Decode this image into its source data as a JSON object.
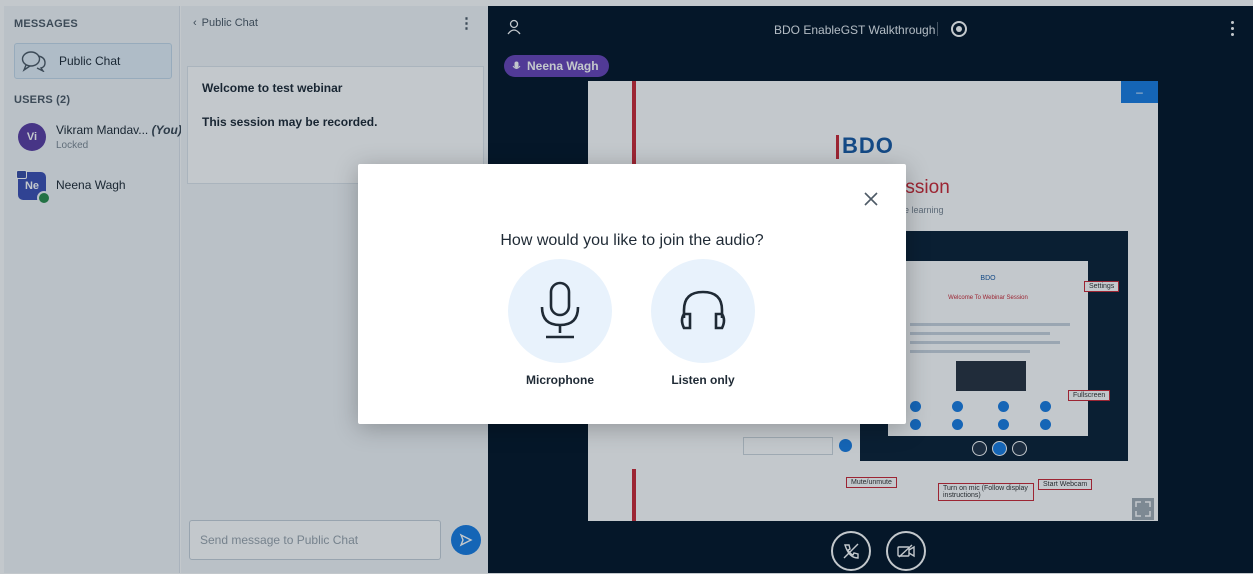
{
  "users_panel": {
    "messages_heading": "MESSAGES",
    "public_chat_entry": "Public Chat",
    "users_heading": "USERS (2)",
    "users": [
      {
        "initials": "Vi",
        "name": "Vikram Mandav...",
        "you_tag": "(You)",
        "status": "Locked",
        "avatar_color": "#5c3fa3"
      },
      {
        "initials": "Ne",
        "name": "Neena Wagh",
        "avatar_color": "#3f51b5",
        "voice_color": "#2f8f4e"
      }
    ]
  },
  "chat": {
    "back_label": "Public Chat",
    "messages": [
      "Welcome to test webinar",
      "This session may be recorded."
    ],
    "input_placeholder": "Send message to Public Chat",
    "accent_color": "#1b7de3"
  },
  "presentation": {
    "meeting_title": "BDO EnableGST Walkthrough",
    "talking_user": "Neena Wagh",
    "slide": {
      "logo": "BDO",
      "heading": "ar Session",
      "subheading": "ce for online learning",
      "inner_logo": "BDO",
      "inner_heading": "Welcome To Webinar Session",
      "callouts": {
        "settings": "Settings",
        "fullscreen": "Fullscreen",
        "mute": "Mute/unmute",
        "mic": "Turn on mic (Follow display instructions)",
        "webcam": "Start Webcam"
      }
    },
    "background_color": "#06172a"
  },
  "audio_modal": {
    "question": "How would you like to join the audio?",
    "options": [
      {
        "label": "Microphone",
        "icon": "microphone-icon"
      },
      {
        "label": "Listen only",
        "icon": "headphones-icon"
      }
    ]
  }
}
